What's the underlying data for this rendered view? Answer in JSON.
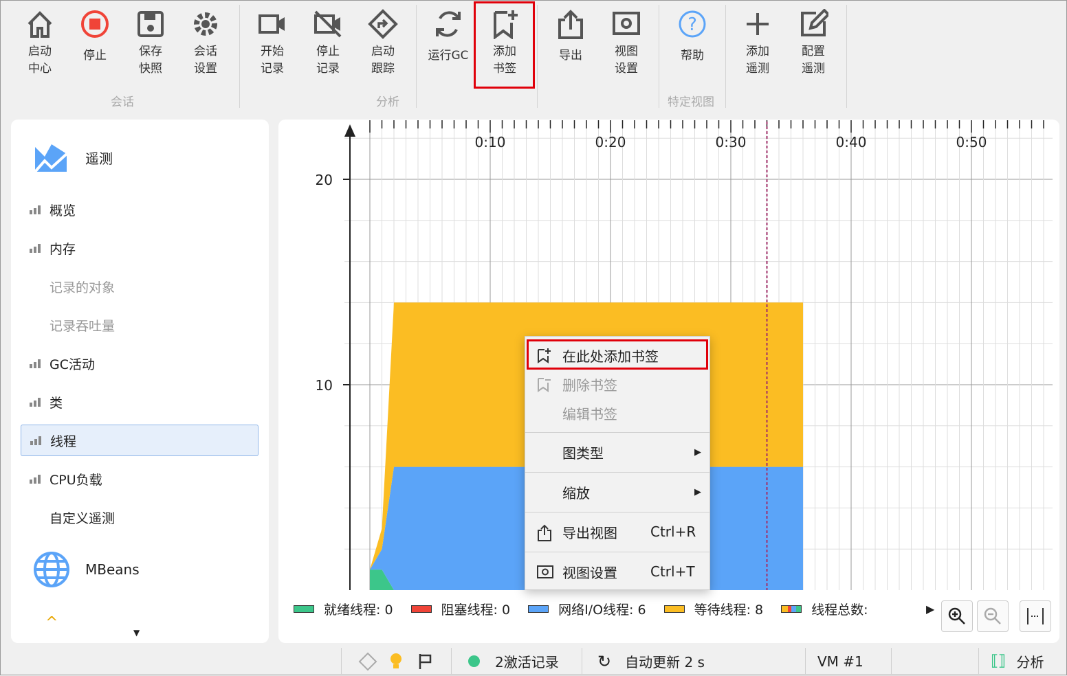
{
  "toolbar": {
    "buttons": [
      {
        "id": "start-center",
        "label": "启动\n中心",
        "icon": "home-icon"
      },
      {
        "id": "stop",
        "label": "停止",
        "icon": "stop-icon"
      },
      {
        "id": "save-snapshot",
        "label": "保存\n快照",
        "icon": "save-icon"
      },
      {
        "id": "session-settings",
        "label": "会话\n设置",
        "icon": "gear-icon"
      },
      {
        "id": "start-recording",
        "label": "开始\n记录",
        "icon": "video-icon"
      },
      {
        "id": "stop-recording",
        "label": "停止\n记录",
        "icon": "video-off-icon"
      },
      {
        "id": "start-tracking",
        "label": "启动\n跟踪",
        "icon": "route-icon"
      },
      {
        "id": "run-gc",
        "label": "运行GC",
        "icon": "refresh-icon"
      },
      {
        "id": "add-bookmark",
        "label": "添加\n书签",
        "icon": "bookmark-add-icon"
      },
      {
        "id": "export",
        "label": "导出",
        "icon": "export-icon"
      },
      {
        "id": "view-settings",
        "label": "视图\n设置",
        "icon": "view-settings-icon"
      },
      {
        "id": "help",
        "label": "帮助",
        "icon": "help-icon"
      },
      {
        "id": "add-telemetry",
        "label": "添加\n遥测",
        "icon": "plus-icon"
      },
      {
        "id": "configure-telemetry",
        "label": "配置\n遥测",
        "icon": "edit-icon"
      }
    ],
    "groups": [
      "会话",
      "分析",
      "特定视图"
    ]
  },
  "sidebar": {
    "header": "遥测",
    "items": [
      {
        "label": "概览",
        "chart": true
      },
      {
        "label": "内存",
        "chart": true
      },
      {
        "label": "记录的对象",
        "dim": true
      },
      {
        "label": "记录吞吐量",
        "dim": true
      },
      {
        "label": "GC活动",
        "chart": true
      },
      {
        "label": "类",
        "chart": true
      },
      {
        "label": "线程",
        "chart": true,
        "selected": true
      },
      {
        "label": "CPU负载",
        "chart": true
      },
      {
        "label": "自定义遥测"
      }
    ],
    "mbeans": "MBeans"
  },
  "chart_data": {
    "type": "area",
    "stacked": true,
    "x_tick_labels": [
      "0:10",
      "0:20",
      "0:30",
      "0:40",
      "0:50"
    ],
    "x_ticks": [
      10,
      20,
      30,
      40,
      50
    ],
    "y_ticks": [
      10,
      20
    ],
    "xlim": [
      0,
      56.7
    ],
    "ylim": [
      0,
      22.7
    ],
    "marker_time": 33,
    "x": [
      0,
      1,
      2,
      36
    ],
    "series": [
      {
        "name": "就绪线程",
        "color": "#3cc68a",
        "values": [
          1,
          1,
          0,
          0
        ]
      },
      {
        "name": "阻塞线程",
        "color": "#f04438",
        "values": [
          0,
          0,
          0,
          0
        ]
      },
      {
        "name": "网络I/O线程",
        "color": "#5ba4f8",
        "values": [
          0,
          1,
          6,
          6
        ]
      },
      {
        "name": "等待线程",
        "color": "#fbbd23",
        "values": [
          0,
          1,
          8,
          8
        ]
      }
    ]
  },
  "legend": [
    {
      "label": "就绪线程: 0",
      "color": "#3cc68a"
    },
    {
      "label": "阻塞线程: 0",
      "color": "#f04438"
    },
    {
      "label": "网络I/O线程: 6",
      "color": "#5ba4f8"
    },
    {
      "label": "等待线程: 8",
      "color": "#fbbd23"
    },
    {
      "label": "线程总数:",
      "color": "multi"
    }
  ],
  "menu": {
    "add_bookmark": "在此处添加书签",
    "delete_bookmark": "删除书签",
    "edit_bookmark": "编辑书签",
    "chart_type": "图类型",
    "zoom": "缩放",
    "export_view": "导出视图",
    "export_shortcut": "Ctrl+R",
    "view_settings": "视图设置",
    "view_settings_shortcut": "Ctrl+T"
  },
  "status": {
    "recordings": "2激活记录",
    "auto_update": "自动更新 2 s",
    "vm": "VM #1",
    "analysis": "分析"
  }
}
